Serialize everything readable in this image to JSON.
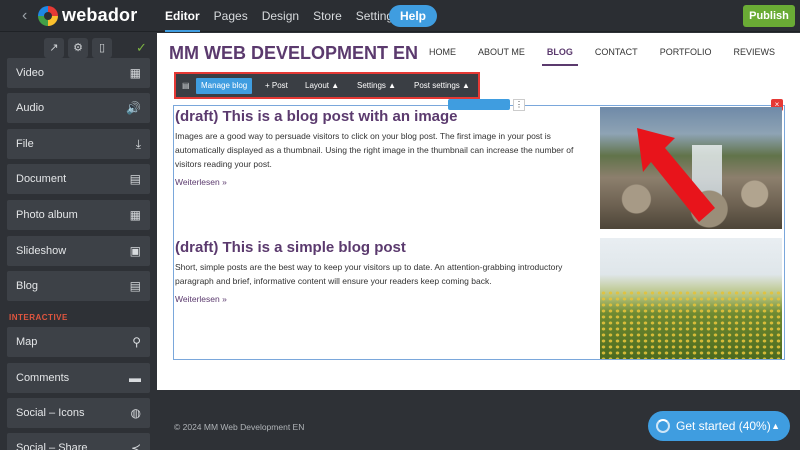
{
  "topbar": {
    "brand": "webador",
    "nav": [
      "Editor",
      "Pages",
      "Design",
      "Store",
      "Settings"
    ],
    "help": "Help",
    "publish": "Publish"
  },
  "sidebar": {
    "items": [
      {
        "label": "Video",
        "icon": "film-icon"
      },
      {
        "label": "Audio",
        "icon": "speaker-icon"
      },
      {
        "label": "File",
        "icon": "download-icon"
      },
      {
        "label": "Document",
        "icon": "document-icon"
      },
      {
        "label": "Photo album",
        "icon": "grid-icon"
      },
      {
        "label": "Slideshow",
        "icon": "slideshow-icon"
      },
      {
        "label": "Blog",
        "icon": "blog-icon"
      }
    ],
    "section": "INTERACTIVE",
    "interactive": [
      {
        "label": "Map",
        "icon": "map-pin-icon"
      },
      {
        "label": "Comments",
        "icon": "comment-icon"
      },
      {
        "label": "Social – Icons",
        "icon": "globe-icon"
      },
      {
        "label": "Social – Share",
        "icon": "share-icon"
      }
    ]
  },
  "site": {
    "title": "MM WEB DEVELOPMENT EN",
    "nav": [
      "HOME",
      "ABOUT ME",
      "BLOG",
      "CONTACT",
      "PORTFOLIO",
      "REVIEWS"
    ],
    "active_nav": "BLOG"
  },
  "blog_toolbar": {
    "manage": "Manage blog",
    "post": "+ Post",
    "layout": "Layout",
    "settings": "Settings",
    "post_settings": "Post settings"
  },
  "posts": [
    {
      "title": "(draft) This is a blog post with an image",
      "body": "Images are a good way to persuade visitors to click on your blog post. The first image in your post is automatically displayed as a thumbnail. Using the right image in the thumbnail can increase the number of visitors reading your post.",
      "more": "Weiterlesen »"
    },
    {
      "title": "(draft) This is a simple blog post",
      "body": "Short, simple posts are the best way to keep your visitors up to date. An attention-grabbing introductory paragraph and brief, informative content will ensure your readers keep coming back.",
      "more": "Weiterlesen »"
    }
  ],
  "footer": {
    "copyright": "© 2024 MM Web Development EN",
    "get_started": "Get started (40%)",
    "progress_percent": 40
  },
  "colors": {
    "accent": "#3f9de0",
    "site_brand": "#5b3a6e",
    "highlight": "#e53935",
    "publish": "#6aab35"
  }
}
